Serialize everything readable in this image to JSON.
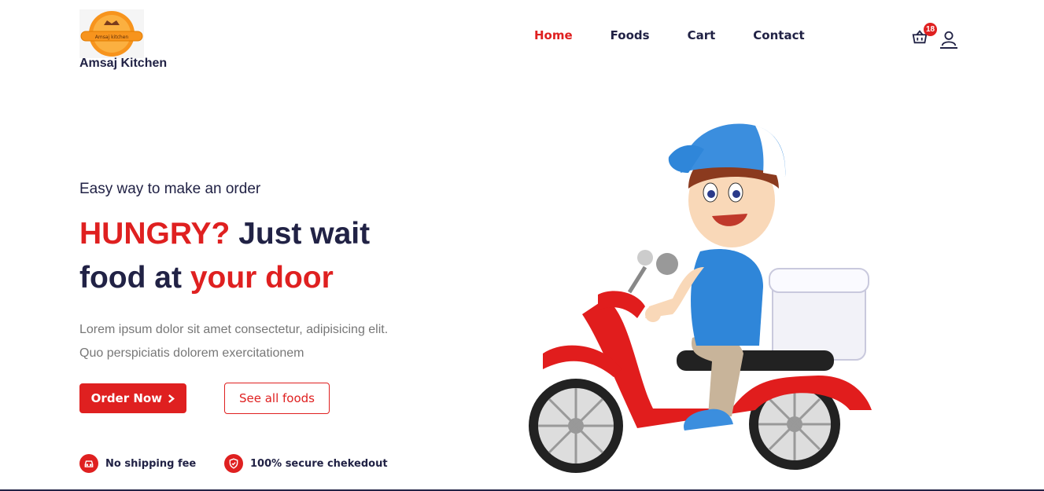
{
  "brand": {
    "name": "Amsaj Kitchen",
    "badge_text": "Amsaj kitchen"
  },
  "nav": {
    "items": [
      {
        "label": "Home",
        "active": true
      },
      {
        "label": "Foods",
        "active": false
      },
      {
        "label": "Cart",
        "active": false
      },
      {
        "label": "Contact",
        "active": false
      }
    ]
  },
  "cart": {
    "count": "18",
    "icon": "basket-icon"
  },
  "user": {
    "icon": "user-icon"
  },
  "hero": {
    "subtitle": "Easy way to make an order",
    "title_part1": "HUNGRY?",
    "title_part2": " Just wait",
    "title_part3": "food at ",
    "title_part4": "your door",
    "desc_line1": "Lorem ipsum dolor sit amet consectetur, adipisicing elit.",
    "desc_line2": "Quo perspiciatis dolorem exercitationem",
    "order_button": "Order Now",
    "order_button_icon": "chevron-right-icon",
    "all_foods_button": "See all foods",
    "features": [
      {
        "label": "No shipping fee",
        "icon": "car-icon"
      },
      {
        "label": "100% secure chekedout",
        "icon": "shield-icon"
      }
    ]
  },
  "colors": {
    "accent": "#df2020",
    "primary": "#212245"
  }
}
